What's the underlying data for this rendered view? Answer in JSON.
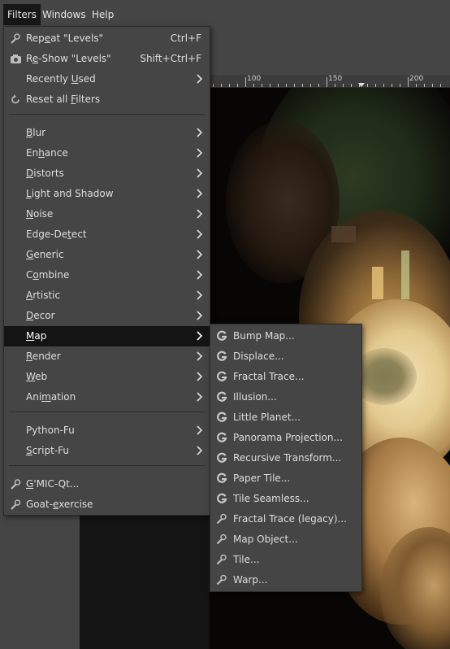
{
  "menubar": [
    {
      "label": "Filters",
      "active": true
    },
    {
      "label": "Windows",
      "active": false
    },
    {
      "label": "Help",
      "active": false
    }
  ],
  "ruler": {
    "labels": [
      "100",
      "150",
      "200"
    ]
  },
  "filters_menu": {
    "groups": [
      [
        {
          "pre": "Rep",
          "mn": "e",
          "post": "at \"Levels\"",
          "shortcut": "Ctrl+F",
          "icon": "repeat-icon"
        },
        {
          "pre": "R",
          "mn": "e",
          "post": "-Show \"Levels\"",
          "shortcut": "Shift+Ctrl+F",
          "icon": "reshow-icon"
        },
        {
          "pre": "Recently ",
          "mn": "U",
          "post": "sed",
          "submenu": true,
          "icon": ""
        },
        {
          "pre": "Reset all ",
          "mn": "F",
          "post": "ilters",
          "icon": "reset-icon"
        }
      ],
      [
        {
          "pre": "",
          "mn": "B",
          "post": "lur",
          "submenu": true
        },
        {
          "pre": "En",
          "mn": "h",
          "post": "ance",
          "submenu": true
        },
        {
          "pre": "",
          "mn": "D",
          "post": "istorts",
          "submenu": true
        },
        {
          "pre": "",
          "mn": "L",
          "post": "ight and Shadow",
          "submenu": true
        },
        {
          "pre": "",
          "mn": "N",
          "post": "oise",
          "submenu": true
        },
        {
          "pre": "Edge-De",
          "mn": "t",
          "post": "ect",
          "submenu": true
        },
        {
          "pre": "",
          "mn": "G",
          "post": "eneric",
          "submenu": true
        },
        {
          "pre": "C",
          "mn": "o",
          "post": "mbine",
          "submenu": true
        },
        {
          "pre": "",
          "mn": "A",
          "post": "rtistic",
          "submenu": true
        },
        {
          "pre": "",
          "mn": "D",
          "post": "ecor",
          "submenu": true
        },
        {
          "pre": "",
          "mn": "M",
          "post": "ap",
          "submenu": true,
          "highlighted": true
        },
        {
          "pre": "",
          "mn": "R",
          "post": "ender",
          "submenu": true
        },
        {
          "pre": "",
          "mn": "W",
          "post": "eb",
          "submenu": true
        },
        {
          "pre": "Ani",
          "mn": "m",
          "post": "ation",
          "submenu": true
        }
      ],
      [
        {
          "pre": "Python-Fu",
          "mn": "",
          "post": "",
          "submenu": true
        },
        {
          "pre": "",
          "mn": "S",
          "post": "cript-Fu",
          "submenu": true
        }
      ],
      [
        {
          "pre": "",
          "mn": "G",
          "post": "'MIC-Qt...",
          "icon": "plugin-icon"
        },
        {
          "pre": "Goat-",
          "mn": "e",
          "post": "xercise",
          "icon": "plugin-icon"
        }
      ]
    ]
  },
  "map_submenu": {
    "items": [
      {
        "label": "Bump Map...",
        "icon": "gegl-icon"
      },
      {
        "label": "Displace...",
        "icon": "gegl-icon"
      },
      {
        "label": "Fractal Trace...",
        "icon": "gegl-icon"
      },
      {
        "label": "Illusion...",
        "icon": "gegl-icon"
      },
      {
        "label": "Little Planet...",
        "icon": "gegl-icon"
      },
      {
        "label": "Panorama Projection...",
        "icon": "gegl-icon"
      },
      {
        "label": "Recursive Transform...",
        "icon": "gegl-icon"
      },
      {
        "label": "Paper Tile...",
        "icon": "gegl-icon"
      },
      {
        "label": "Tile Seamless...",
        "icon": "gegl-icon"
      },
      {
        "label": "Fractal Trace (legacy)...",
        "icon": "plugin-icon"
      },
      {
        "label": "Map Object...",
        "icon": "plugin-icon"
      },
      {
        "label": "Tile...",
        "icon": "plugin-icon"
      },
      {
        "label": "Warp...",
        "icon": "plugin-icon"
      }
    ]
  },
  "colors": {
    "menu_bg": "#454545",
    "highlight_bg": "#141414",
    "text": "#dedede"
  }
}
